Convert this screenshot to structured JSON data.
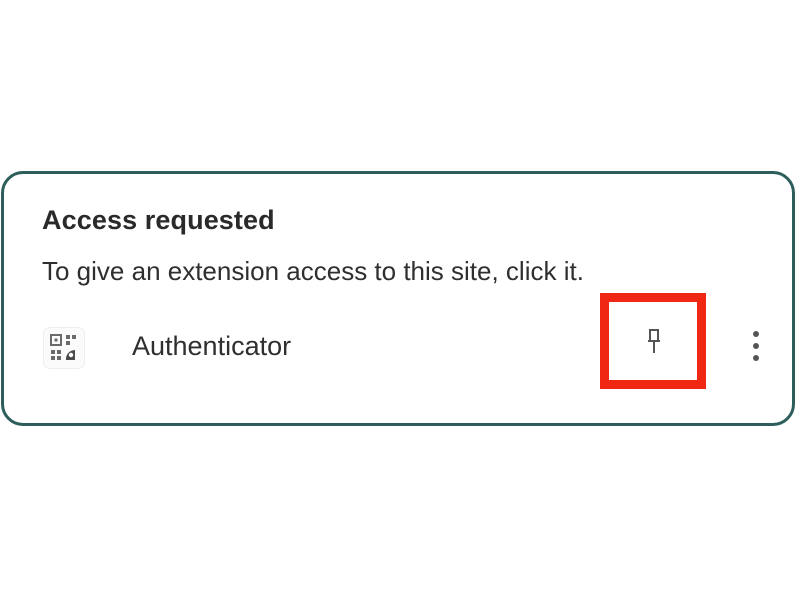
{
  "panel": {
    "title": "Access requested",
    "description": "To give an extension access to this site, click it."
  },
  "extension": {
    "name": "Authenticator",
    "icon": "qr-code-icon",
    "pin_icon": "pin-icon",
    "more_icon": "more-vert-icon"
  },
  "colors": {
    "panel_border": "#2e5e5b",
    "highlight": "#f02712",
    "text": "#2f2f2f",
    "icon": "#555555"
  }
}
